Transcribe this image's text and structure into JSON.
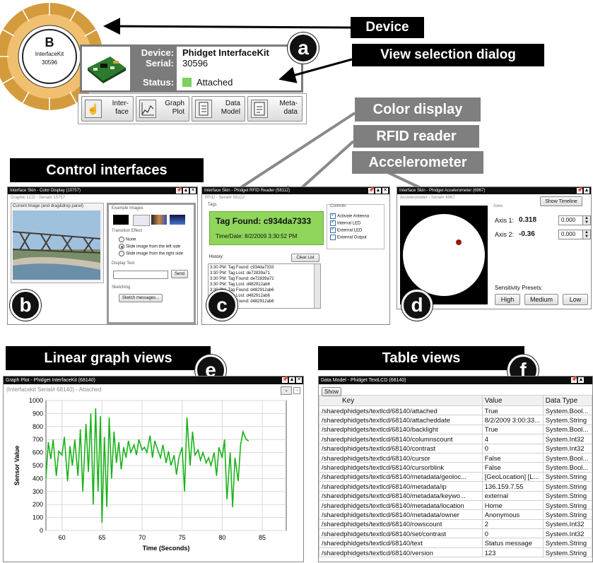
{
  "callouts": {
    "device": "Device",
    "view_selection": "View selection dialog",
    "color_display": "Color display",
    "rfid_reader": "RFID reader",
    "accelerometer": "Accelerometer",
    "control_interfaces": "Control interfaces",
    "linear_graph": "Linear graph views",
    "table_views": "Table views"
  },
  "badges": {
    "a": "a",
    "b": "b",
    "c": "c",
    "d": "d",
    "e": "e",
    "f": "f"
  },
  "device_node": {
    "letter": "B",
    "name": "InterfaceKit",
    "serial": "30596"
  },
  "device_panel": {
    "device_label": "Device:",
    "device_value": "Phidget InterfaceKit",
    "serial_label": "Serial:",
    "serial_value": "30596",
    "status_label": "Status:",
    "status_value": "Attached"
  },
  "view_buttons": [
    {
      "l1": "Inter-",
      "l2": "face"
    },
    {
      "l1": "Graph",
      "l2": "Plot"
    },
    {
      "l1": "Data",
      "l2": "Model"
    },
    {
      "l1": "Meta-",
      "l2": "data"
    }
  ],
  "color_win": {
    "title": "Interface Skin - Color Display (10757)",
    "subtitle": "Graphic LCD - Serial# 15757",
    "current_image": "Current Image (and drag&drop panel)",
    "example_images": "Example Images",
    "transition": "Transition Effect",
    "opt_none": "None",
    "opt_left": "Slide image from the left side",
    "opt_right": "Slide image from the right side",
    "display_text": "Display Text",
    "send": "Send",
    "sketching": "Sketching",
    "sketch_btn": "Sketch messages..."
  },
  "rfid_win": {
    "title": "Interface Skin - Phidget RFID Reader (58112)",
    "subtitle": "RFID - Serial# 58112",
    "tags": "Tags",
    "tag_found": "Tag Found: c934da7333",
    "time_date": "Time/Date: 8/2/2009 3:30:52 PM",
    "controls": "Controls",
    "ctrl": [
      "Activate Antenna",
      "Internal LED",
      "External LED",
      "External Output"
    ],
    "history": "History:",
    "clear": "Clear List",
    "log": [
      "3:30 PM: Tag Found: c934da7333",
      "3:30 PM: Tag Lost: de72839a71",
      "3:30 PM: Tag Found: de72839a71",
      "3:30 PM: Tag Lost: d482912ab6",
      "3:30 PM: Tag Found: d482912ab6",
      "3:30 PM: Tag Lost: d482912ab6",
      "3:30 PM: Tag Found: d482912ab6"
    ]
  },
  "accel_win": {
    "title": "Interface Skin - Phidget Accelerometer (6967)",
    "subtitle": "Accelerometer - Serial# 6967",
    "show_timeline": "Show Timeline",
    "axes": "Axes",
    "axis1_label": "Axis 1:",
    "axis1_value": "0.318",
    "axis1_input": "0.000",
    "axis2_label": "Axis 2:",
    "axis2_value": "-0.36",
    "axis2_input": "0.000",
    "presets": "Sensitivity Presets:",
    "high": "High",
    "medium": "Medium",
    "low": "Low"
  },
  "graph_win": {
    "title": "Graph Plot - Phidget InterfaceKit (68140)",
    "subtitle": "(Interfacekit Serial# 68140) - Attached"
  },
  "chart_data": {
    "type": "line",
    "xlabel": "Time (Seconds)",
    "ylabel": "Sensor Value",
    "xlim": [
      58,
      88
    ],
    "ylim": [
      0,
      1000
    ],
    "xticks": [
      60,
      65,
      70,
      75,
      80,
      85
    ],
    "yticks": [
      0,
      100,
      200,
      300,
      400,
      500,
      600,
      700,
      800,
      900,
      1000
    ],
    "grid": true,
    "series": [
      {
        "color": "#19b319",
        "x": [
          58.0,
          58.3,
          58.6,
          58.9,
          59.3,
          59.6,
          60.0,
          60.3,
          60.7,
          61.0,
          61.3,
          61.6,
          62.0,
          62.3,
          62.6,
          63.0,
          63.3,
          63.6,
          63.9,
          64.2,
          64.5,
          64.8,
          65.0,
          65.3,
          65.6,
          65.9,
          66.2,
          66.5,
          66.8,
          67.1,
          67.4,
          67.7,
          68.0,
          68.3,
          68.6,
          69.0,
          69.3,
          69.6,
          70.0,
          70.3,
          70.6,
          71.0,
          71.3,
          71.6,
          72.0,
          72.3,
          72.6,
          73.0,
          73.3,
          73.6,
          74.0,
          74.3,
          74.6,
          75.0,
          75.3,
          75.6,
          76.0,
          76.3,
          76.6,
          77.0,
          77.3,
          77.6,
          78.0,
          78.3,
          78.6,
          79.0,
          79.3,
          79.6,
          80.0,
          80.3,
          80.6,
          81.0,
          81.3,
          81.6,
          82.0,
          82.3,
          82.6,
          83.0,
          83.3
        ],
        "y": [
          400,
          680,
          550,
          700,
          420,
          610,
          580,
          720,
          380,
          650,
          500,
          700,
          420,
          780,
          300,
          820,
          450,
          900,
          200,
          940,
          300,
          880,
          60,
          720,
          180,
          870,
          400,
          760,
          520,
          680,
          470,
          640,
          560,
          690,
          600,
          660,
          580,
          700,
          620,
          640,
          600,
          730,
          560,
          690,
          610,
          560,
          660,
          520,
          610,
          500,
          580,
          430,
          560,
          640,
          300,
          870,
          500,
          760,
          580,
          620,
          540,
          600,
          520,
          560,
          500,
          600,
          420,
          640,
          560,
          700,
          240,
          600,
          180,
          560,
          380,
          660,
          760,
          700,
          690
        ]
      }
    ]
  },
  "table_win": {
    "title": "Data Model - Phidget TextLCD (68140)",
    "show": "Show",
    "headers": [
      "Key",
      "Value",
      "Data Type"
    ],
    "rows": [
      [
        "/sharedphidgets/textlcd/68140/attached",
        "True",
        "System.Bool..."
      ],
      [
        "/sharedphidgets/textlcd/68140/attacheddate",
        "8/2/2009 3:00:33...",
        "System.String"
      ],
      [
        "/sharedphidgets/textlcd/68140/backlight",
        "True",
        "System.Bool..."
      ],
      [
        "/sharedphidgets/textlcd/68140/columnscount",
        "4",
        "System.Int32"
      ],
      [
        "/sharedphidgets/textlcd/68140/contrast",
        "0",
        "System.Int32"
      ],
      [
        "/sharedphidgets/textlcd/68140/cursor",
        "False",
        "System.Bool..."
      ],
      [
        "/sharedphidgets/textlcd/68140/cursorblink",
        "False",
        "System.Bool..."
      ],
      [
        "/sharedphidgets/textlcd/68140/metadata/geoloc...",
        "[GeoLocation] [L...",
        "System.String"
      ],
      [
        "/sharedphidgets/textlcd/68140/metadata/ip",
        "136.159.7.55",
        "System.String"
      ],
      [
        "/sharedphidgets/textlcd/68140/metadata/keywo...",
        "external",
        "System.String"
      ],
      [
        "/sharedphidgets/textlcd/68140/metadata/location",
        "Home",
        "System.String"
      ],
      [
        "/sharedphidgets/textlcd/68140/metadata/owner",
        "Anonymous",
        "System.String"
      ],
      [
        "/sharedphidgets/textlcd/68140/rowscount",
        "2",
        "System.Int32"
      ],
      [
        "/sharedphidgets/textlcd/68140/set/contrast",
        "0",
        "System.Int32"
      ],
      [
        "/sharedphidgets/textlcd/68140/text",
        "Status message",
        "System.String"
      ],
      [
        "/sharedphidgets/textlcd/68140/version",
        "123",
        "System.String"
      ]
    ]
  },
  "colors": {
    "tag_green": "#8fd65a",
    "status_green": "#7fcf62",
    "ring_gold": "#d39a3a",
    "line_green": "#19b319"
  }
}
